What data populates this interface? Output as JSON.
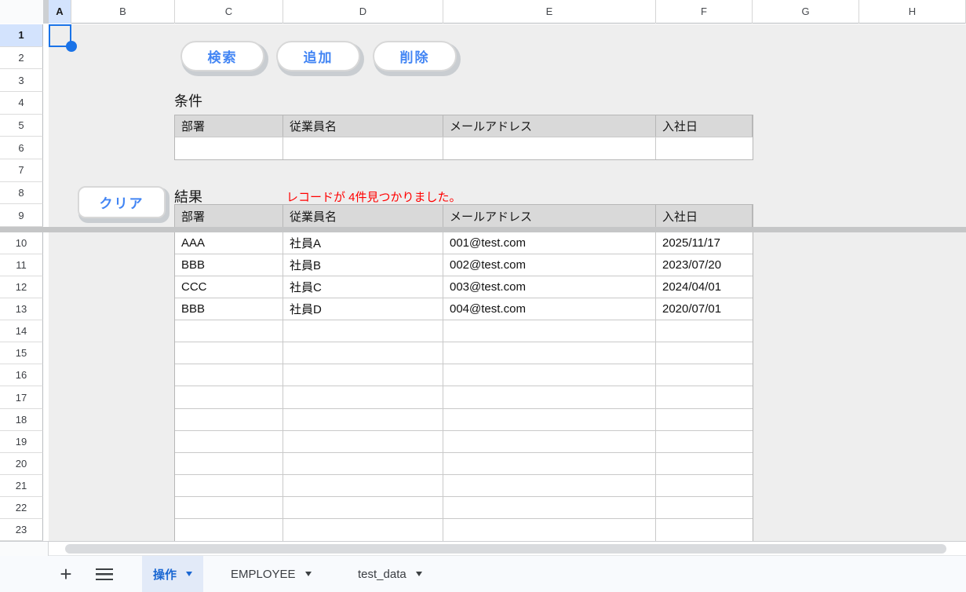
{
  "colors": {
    "accent_blue": "#4285f4",
    "selection_blue": "#1a73e8",
    "selected_header_bg": "#d3e3fd",
    "table_header_bg": "#d9d9d9",
    "canvas_bg": "#eeeeee",
    "message_red": "#ff0000",
    "active_tab_bg": "#e2eaf8",
    "active_tab_text": "#1a67d2"
  },
  "grid": {
    "column_headers": [
      "A",
      "B",
      "C",
      "D",
      "E",
      "F",
      "G",
      "H"
    ],
    "selected_column": "A",
    "row_numbers": [
      1,
      2,
      3,
      4,
      5,
      6,
      7,
      8,
      9,
      10,
      11,
      12,
      13,
      14,
      15,
      16,
      17,
      18,
      19,
      20,
      21,
      22,
      23
    ],
    "selected_row": 1,
    "frozen_divider_after_row": 9
  },
  "toolbar": {
    "search_label": "検索",
    "add_label": "追加",
    "delete_label": "削除",
    "clear_label": "クリア"
  },
  "condition": {
    "title": "条件",
    "headers": [
      "部署",
      "従業員名",
      "メールアドレス",
      "入社日"
    ],
    "input_values": [
      "",
      "",
      "",
      ""
    ]
  },
  "results": {
    "title": "結果",
    "message": "レコードが 4件見つかりました。",
    "headers": [
      "部署",
      "従業員名",
      "メールアドレス",
      "入社日"
    ],
    "rows": [
      [
        "AAA",
        "社員A",
        "001@test.com",
        "2025/11/17"
      ],
      [
        "BBB",
        "社員B",
        "002@test.com",
        "2023/07/20"
      ],
      [
        "CCC",
        "社員C",
        "003@test.com",
        "2024/04/01"
      ],
      [
        "BBB",
        "社員D",
        "004@test.com",
        "2020/07/01"
      ]
    ],
    "empty_row_count": 10
  },
  "sheet_tabs": {
    "add_icon": "+",
    "tabs": [
      {
        "label": "操作",
        "active": true
      },
      {
        "label": "EMPLOYEE",
        "active": false
      },
      {
        "label": "test_data",
        "active": false
      }
    ]
  }
}
